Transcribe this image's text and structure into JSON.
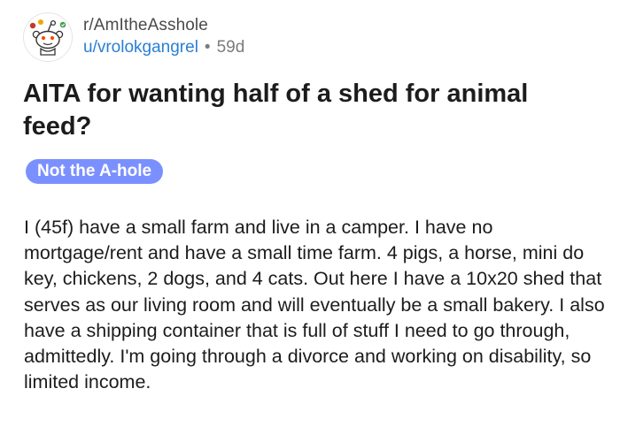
{
  "post": {
    "subreddit": "r/AmItheAsshole",
    "username": "u/vrolokgangrel",
    "separator": "•",
    "age": "59d",
    "title": "AITA for wanting half of a shed for animal feed?",
    "flair": "Not the A-hole",
    "body": "I (45f) have a small farm and live in a camper. I have no mortgage/rent and have a small time farm. 4 pigs, a horse, mini do key, chickens, 2 dogs, and 4 cats. Out here I have a 10x20 shed that serves as our living room and will eventually be a small bakery. I also have a shipping container that is full of stuff I need to go through, admittedly. I'm going through a divorce and working on disability, so limited income."
  },
  "icons": {
    "avatar": "subreddit-snoo-avatar-icon"
  },
  "colors": {
    "username": "#2a7fd6",
    "flair_background": "#7b90ff",
    "text": "#1c1c1c",
    "muted": "#7c7c7c"
  }
}
